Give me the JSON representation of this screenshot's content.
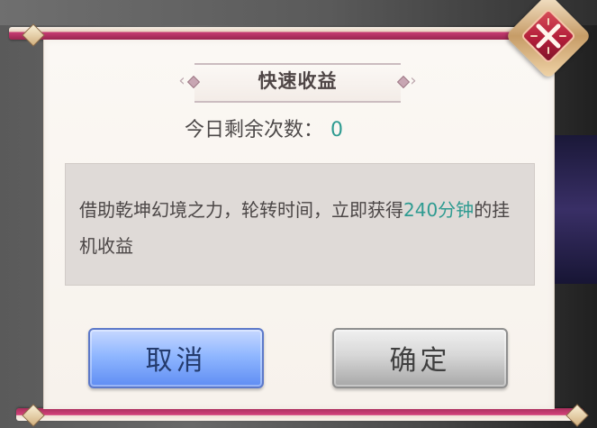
{
  "dialog": {
    "title": "快速收益",
    "remaining": {
      "label": "今日剩余次数：",
      "value": "0"
    },
    "description": {
      "prefix": "借助乾坤幻境之力，轮转时间，立即获得",
      "highlight": "240分钟",
      "suffix": "的挂机收益"
    },
    "buttons": {
      "cancel": "取消",
      "confirm": "确定"
    }
  },
  "colors": {
    "accent_green": "#2e9b91",
    "cancel_button": "#7ea3f5",
    "confirm_button": "#c8c8c8",
    "close_button": "#b31e3a",
    "frame_magenta": "#c73b73"
  },
  "icons": {
    "close": "close-icon"
  }
}
